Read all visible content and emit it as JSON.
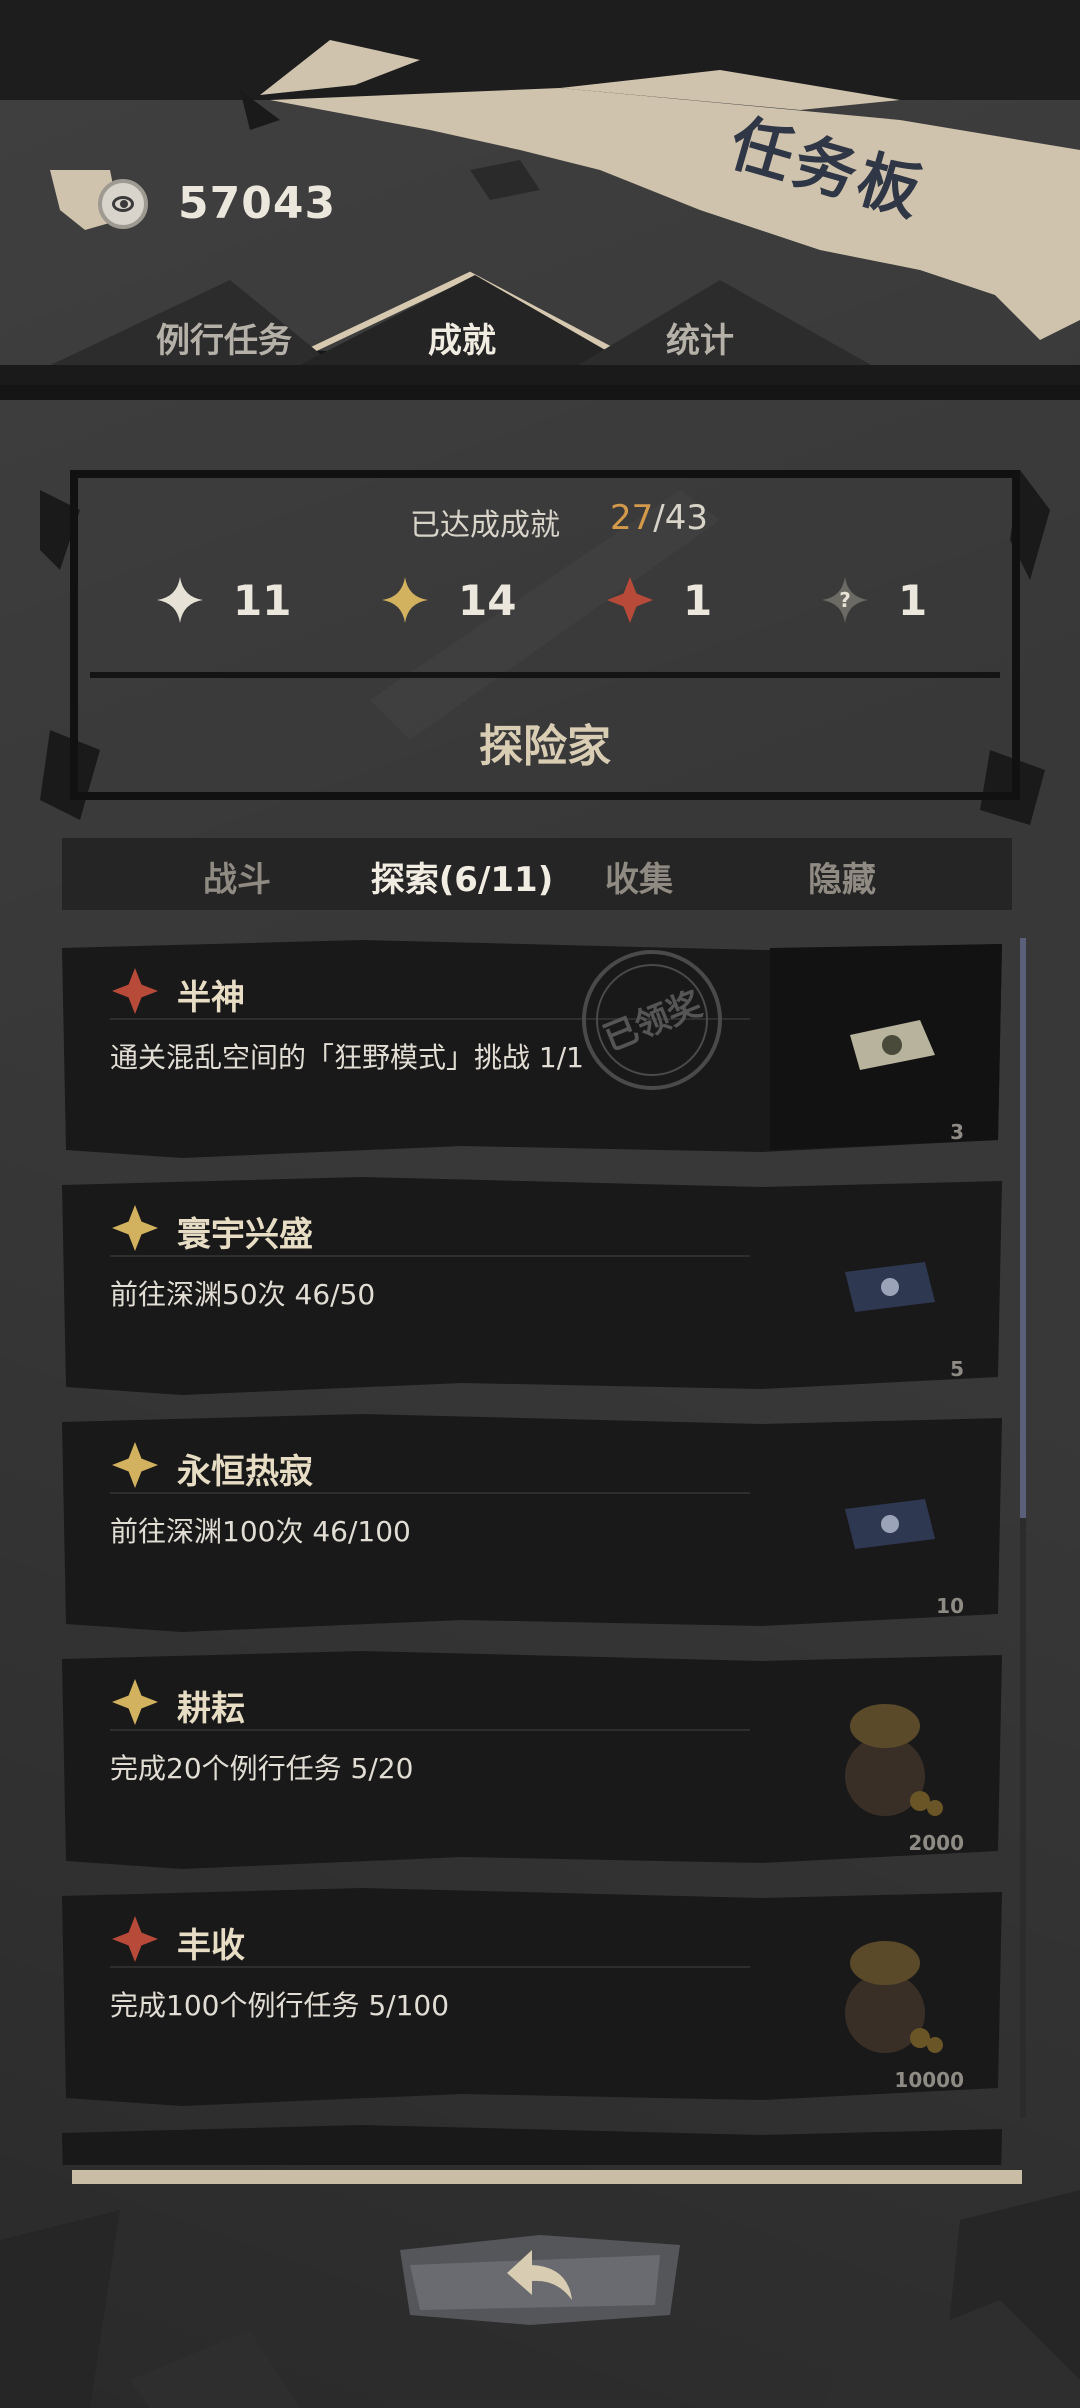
{
  "header": {
    "title": "任务板",
    "currency_value": "57043",
    "currency_icon": "coin-eye-icon"
  },
  "main_tabs": [
    {
      "label": "例行任务",
      "active": false
    },
    {
      "label": "成就",
      "active": true
    },
    {
      "label": "统计",
      "active": false
    }
  ],
  "summary": {
    "label": "已达成成就",
    "completed": "27",
    "separator": "/",
    "total": "43",
    "stars": [
      {
        "icon": "white-star-icon",
        "color": "#e7e2d6",
        "count": "11"
      },
      {
        "icon": "gold-star-icon",
        "color": "#d2b25f",
        "count": "14"
      },
      {
        "icon": "red-star-icon",
        "color": "#b84a3a",
        "count": "1"
      },
      {
        "icon": "hidden-star-icon",
        "color": "#6c6a64",
        "count": "1"
      }
    ],
    "rank_title": "探险家"
  },
  "sub_tabs": [
    {
      "label": "战斗",
      "active": false
    },
    {
      "label": "探索(6/11)",
      "active": true
    },
    {
      "label": "收集",
      "active": false
    },
    {
      "label": "隐藏",
      "active": false
    }
  ],
  "achievements": [
    {
      "name": "半神",
      "star": "red",
      "desc": "通关混乱空间的「狂野模式」挑战 1/1",
      "reward_count": "3",
      "reward_icon": "banknote-icon",
      "claimed": true,
      "stamp": "已领奖"
    },
    {
      "name": "寰宇兴盛",
      "star": "gold",
      "desc": "前往深渊50次 46/50",
      "reward_count": "5",
      "reward_icon": "blue-ticket-icon",
      "claimed": false
    },
    {
      "name": "永恒热寂",
      "star": "gold",
      "desc": "前往深渊100次 46/100",
      "reward_count": "10",
      "reward_icon": "blue-ticket-icon",
      "claimed": false
    },
    {
      "name": "耕耘",
      "star": "gold",
      "desc": "完成20个例行任务 5/20",
      "reward_count": "2000",
      "reward_icon": "coin-bag-icon",
      "claimed": false
    },
    {
      "name": "丰收",
      "star": "red",
      "desc": "完成100个例行任务 5/100",
      "reward_count": "10000",
      "reward_icon": "coin-bag-icon",
      "claimed": false
    }
  ],
  "colors": {
    "red_star": "#b84a3a",
    "gold_star": "#d2b25f",
    "white_star": "#e7e2d6",
    "accent_count": "#d49a4b",
    "title_ink": "#2f3645",
    "brush": "#cfc3ad"
  },
  "back_button_icon": "back-arrow-icon"
}
